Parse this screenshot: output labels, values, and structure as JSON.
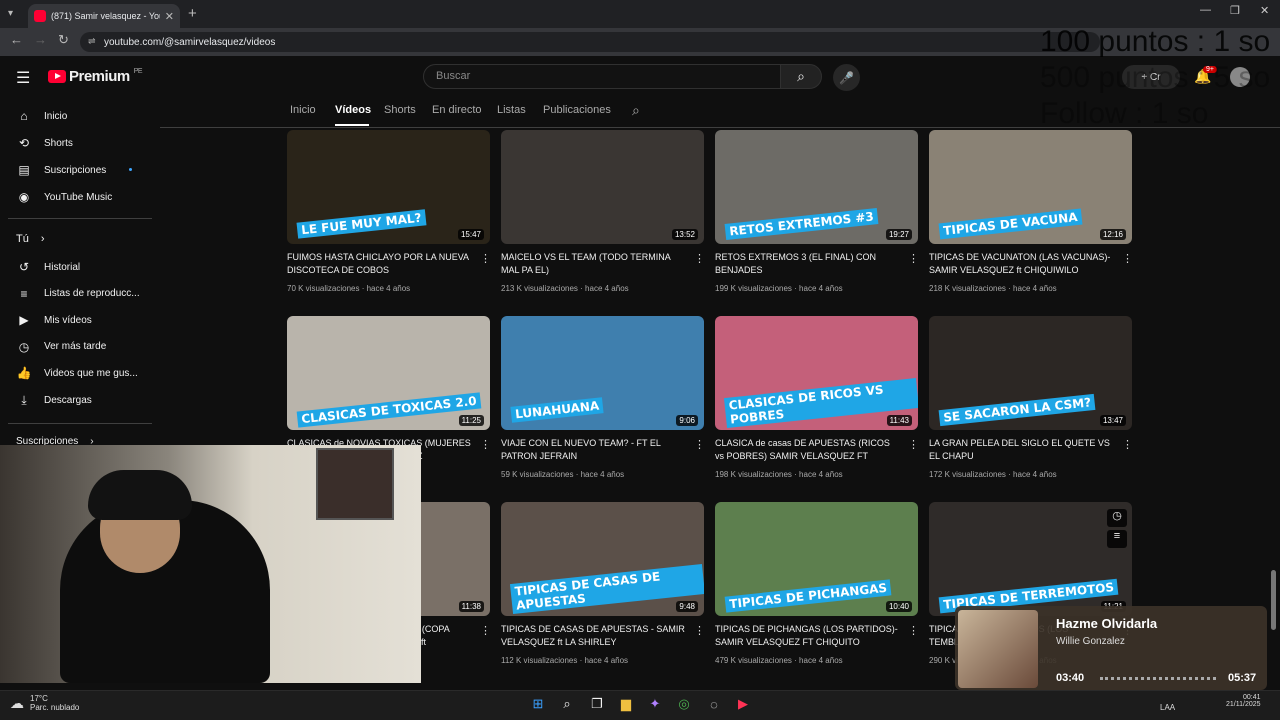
{
  "browser": {
    "tab_title": "(871) Samir velasquez - YouTub",
    "url": "youtube.com/@samirvelasquez/videos",
    "new_tab": "+",
    "tab_close": "✕"
  },
  "header": {
    "logo_text": "Premium",
    "logo_region": "PE",
    "search_placeholder": "Buscar",
    "create_label": "+ Cr",
    "notif_badge": "9+"
  },
  "overlay_text": [
    "100 puntos : 1 so",
    "500 puntos : 5 so",
    "Follow : 1 so"
  ],
  "sidebar": {
    "items": [
      {
        "label": "Inicio",
        "icon": "home-icon",
        "glyph": "⌂"
      },
      {
        "label": "Shorts",
        "icon": "shorts-icon",
        "glyph": "⟲"
      },
      {
        "label": "Suscripciones",
        "icon": "subscriptions-icon",
        "glyph": "▤"
      },
      {
        "label": "YouTube Music",
        "icon": "music-icon",
        "glyph": "◉"
      }
    ],
    "you_label": "Tú",
    "you_items": [
      {
        "label": "Historial",
        "icon": "history-icon",
        "glyph": "↺"
      },
      {
        "label": "Listas de reproducc...",
        "icon": "playlist-icon",
        "glyph": "≡"
      },
      {
        "label": "Mis vídeos",
        "icon": "my-videos-icon",
        "glyph": "▶"
      },
      {
        "label": "Ver más tarde",
        "icon": "watch-later-icon",
        "glyph": "◷"
      },
      {
        "label": "Videos que me gus...",
        "icon": "like-icon",
        "glyph": "👍"
      },
      {
        "label": "Descargas",
        "icon": "download-icon",
        "glyph": "⤓"
      }
    ],
    "subs_label": "Suscripciones"
  },
  "channel_tabs": [
    "Inicio",
    "Vídeos",
    "Shorts",
    "En directo",
    "Listas",
    "Publicaciones"
  ],
  "active_tab": "Vídeos",
  "videos": [
    {
      "title": "FUIMOS HASTA CHICLAYO POR LA NUEVA DISCOTECA DE COBOS",
      "views": "70 K visualizaciones",
      "age": "hace 4 años",
      "duration": "15:47",
      "overlay": "LE FUE MUY MAL?",
      "color": "#2a2419"
    },
    {
      "title": "MAICELO VS EL TEAM (TODO TERMINA MAL PA EL)",
      "views": "213 K visualizaciones",
      "age": "hace 4 años",
      "duration": "13:52",
      "overlay": "",
      "color": "#3a3633"
    },
    {
      "title": "RETOS EXTREMOS 3 (EL FINAL) CON BENJADES",
      "views": "199 K visualizaciones",
      "age": "hace 4 años",
      "duration": "19:27",
      "overlay": "RETOS EXTREMOS #3",
      "color": "#6d6b66"
    },
    {
      "title": "TIPICAS DE VACUNATON (LAS VACUNAS)- SAMIR VELASQUEZ ft CHIQUIWILO",
      "views": "218 K visualizaciones",
      "age": "hace 4 años",
      "duration": "12:16",
      "overlay": "TIPICAS DE VACUNA",
      "color": "#8a8275"
    },
    {
      "title": "CLASICAS de NOVIAS TOXICAS (MUJERES TOXICAS) - SAMIR VELASQUEZ",
      "views": "",
      "age": "",
      "duration": "11:25",
      "overlay": "CLASICAS DE TOXICAS 2.0",
      "color": "#b9b4ab"
    },
    {
      "title": "VIAJE CON EL NUEVO TEAM? - FT EL PATRON JEFRAIN",
      "views": "59 K visualizaciones",
      "age": "hace 4 años",
      "duration": "9:06",
      "overlay": "LUNAHUANA",
      "color": "#3f7fae"
    },
    {
      "title": "CLASICA de casas DE APUESTAS (RICOS vs POBRES) SAMIR VELASQUEZ FT JEFRAIN-...",
      "views": "198 K visualizaciones",
      "age": "hace 4 años",
      "duration": "11:43",
      "overlay": "CLASICAS DE RICOS VS POBRES",
      "color": "#c4607a"
    },
    {
      "title": "LA GRAN PELEA DEL SIGLO EL QUETE VS EL CHAPU",
      "views": "172 K visualizaciones",
      "age": "hace 4 años",
      "duration": "13:47",
      "overlay": "SE SACARON LA CSM?",
      "color": "#2c2724"
    },
    {
      "title": "TIPICAS DE LA COPA AMERICA (COPA AMERICA) SAMIR VELASQUEZ ft CHIQUIT...",
      "views": "",
      "age": "",
      "duration": "11:38",
      "overlay": "",
      "color": "#7a7067"
    },
    {
      "title": "TIPICAS DE CASAS DE APUESTAS - SAMIR VELASQUEZ ft LA SHIRLEY",
      "views": "112 K visualizaciones",
      "age": "hace 4 años",
      "duration": "9:48",
      "overlay": "TIPICAS DE CASAS DE APUESTAS",
      "color": "#5b5049"
    },
    {
      "title": "TIPICAS DE PICHANGAS (LOS PARTIDOS)- SAMIR VELASQUEZ FT CHIQUITO FLORES,...",
      "views": "479 K visualizaciones",
      "age": "hace 4 años",
      "duration": "10:40",
      "overlay": "TIPICAS DE PICHANGAS",
      "color": "#5d7f4e"
    },
    {
      "title": "TIPICAS DE TERREMOTOS (LOS TEMBLORES)",
      "views": "290 K visualizaciones",
      "age": "hace 4 años",
      "duration": "11:21",
      "overlay": "TIPICAS DE TERREMOTOS",
      "color": "#2f2b29"
    }
  ],
  "music": {
    "title": "Hazme Olvidarla",
    "artist": "Willie Gonzalez",
    "elapsed": "03:40",
    "total": "05:37",
    "progress": 0.65
  },
  "taskbar": {
    "temp": "17°C",
    "weather": "Parc. nublado",
    "lang": "LAA",
    "time": "00:41",
    "date": "21/11/2025"
  }
}
